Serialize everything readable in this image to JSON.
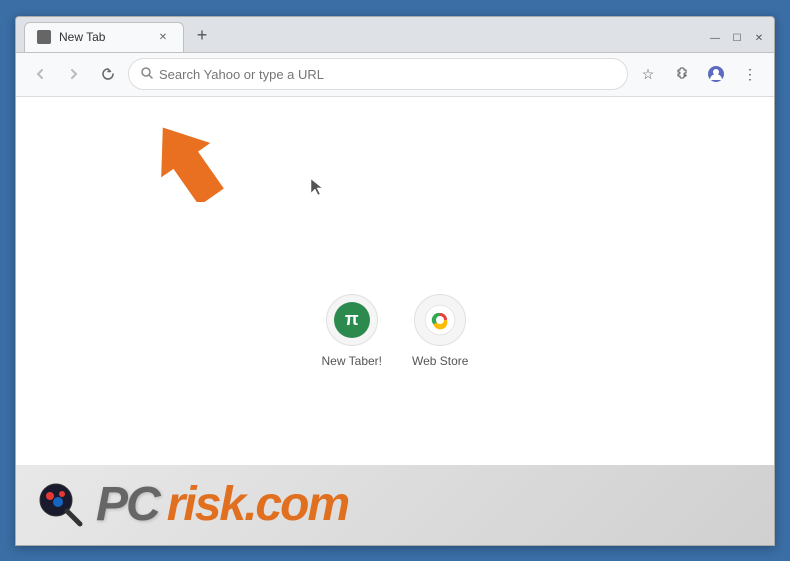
{
  "browser": {
    "tab": {
      "title": "New Tab",
      "favicon": "page-icon"
    },
    "new_tab_button": "+",
    "window_controls": {
      "minimize": "—",
      "maximize": "☐",
      "close": "✕"
    },
    "nav": {
      "back": "←",
      "forward": "→",
      "refresh": "↺",
      "address_placeholder": "Search Yahoo or type a URL",
      "address_value": ""
    },
    "nav_icons": {
      "bookmark": "☆",
      "extensions": "🧩",
      "profile": "👤",
      "menu": "⋮"
    }
  },
  "new_tab": {
    "shortcuts": [
      {
        "label": "New Taber!",
        "icon_type": "newtaber",
        "icon_letter": "π"
      },
      {
        "label": "Web Store",
        "icon_type": "webstore"
      }
    ]
  },
  "watermark": {
    "pc_text": "PC",
    "risk_text": "risk.com"
  },
  "arrow": {
    "color": "#e87020"
  }
}
